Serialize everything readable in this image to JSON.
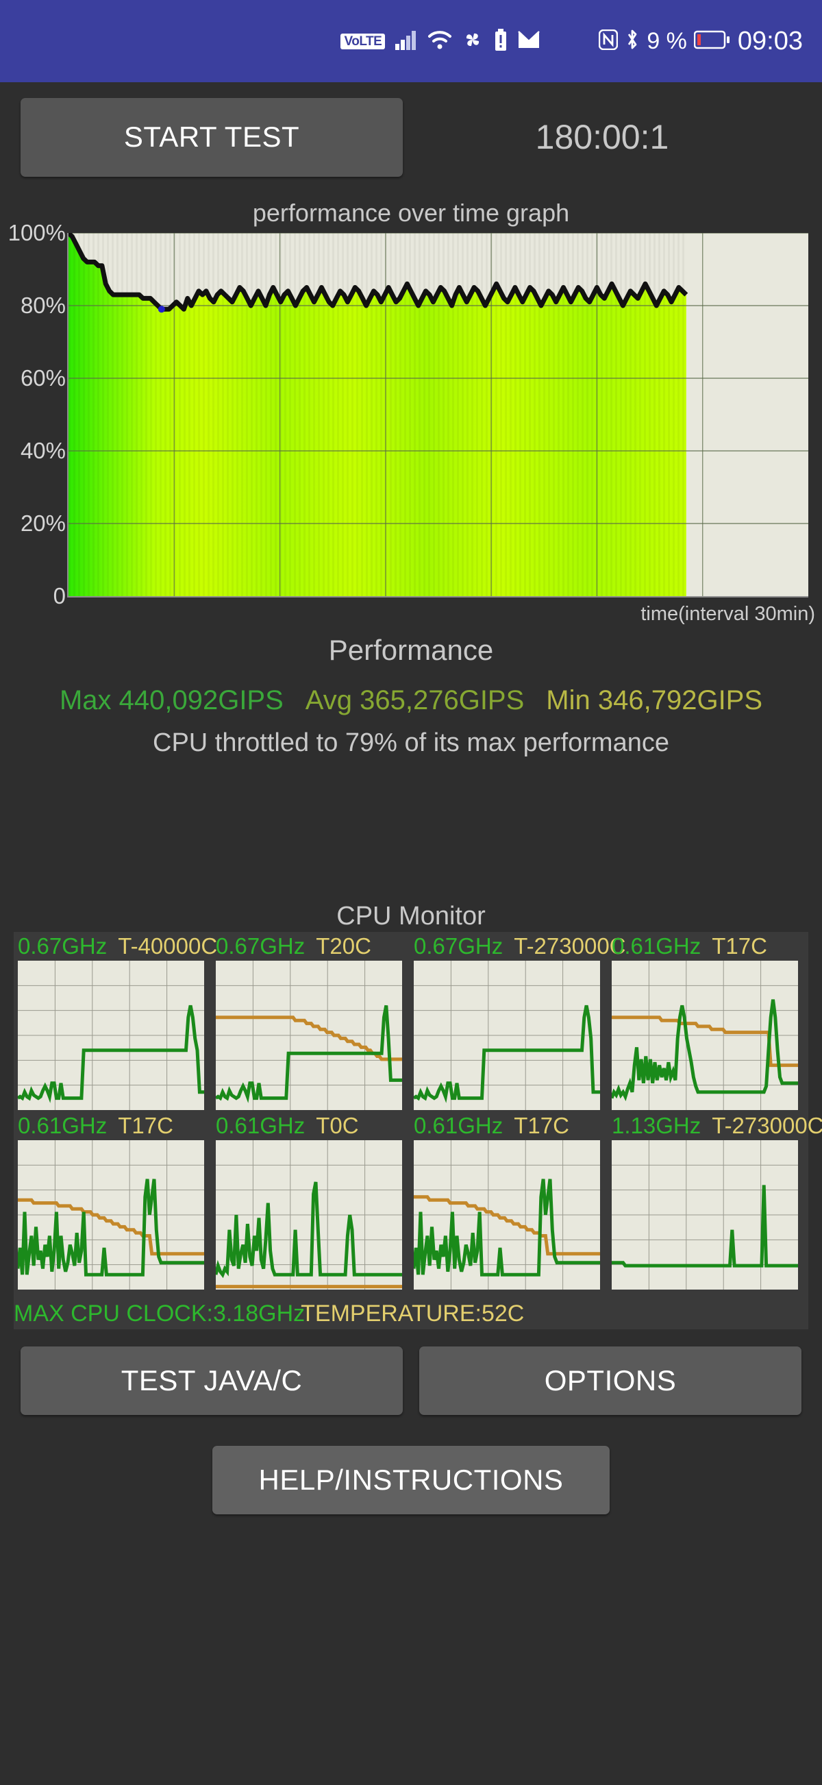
{
  "statusbar": {
    "volte": "VoLTE",
    "icons": [
      "volte-badge",
      "signal-bars-icon",
      "wifi-icon",
      "pinwheel-icon",
      "battery-alert-icon",
      "mail-icon",
      "nfc-icon",
      "bluetooth-icon",
      "battery-icon"
    ],
    "battery_percent": "9 %",
    "time": "09:03",
    "background_color": "#3b3f9e"
  },
  "toolbar": {
    "start_test_label": "START TEST",
    "timer": "180:00:1"
  },
  "chart_data": {
    "type": "line",
    "title": "performance over time graph",
    "xlabel": "time(interval 30min)",
    "ylabel": "",
    "ylim": [
      0,
      100
    ],
    "ytick_labels": [
      "100%",
      "80%",
      "60%",
      "40%",
      "20%",
      "0"
    ],
    "ytick_values": [
      100,
      80,
      60,
      40,
      20,
      0
    ],
    "grid": true,
    "x_gridline_count": 6,
    "fill": "green-to-yellow gradient",
    "line_color": "#111111",
    "plot_background": "#e8e8dd",
    "min_marker_color": "#2222cc",
    "data_fraction_drawn": 0.835,
    "values": [
      100,
      99,
      97,
      95,
      93,
      92,
      92,
      92,
      91,
      91,
      86,
      84,
      83,
      83,
      83,
      83,
      83,
      83,
      83,
      83,
      82,
      82,
      82,
      81,
      80,
      79,
      79,
      79,
      80,
      81,
      80,
      79,
      82,
      80,
      82,
      84,
      83,
      84,
      82,
      81,
      83,
      84,
      83,
      82,
      81,
      83,
      85,
      84,
      82,
      80,
      82,
      84,
      82,
      80,
      83,
      85,
      83,
      81,
      83,
      84,
      82,
      80,
      82,
      84,
      85,
      83,
      81,
      83,
      85,
      83,
      81,
      80,
      82,
      84,
      83,
      81,
      83,
      85,
      84,
      82,
      80,
      82,
      84,
      83,
      81,
      83,
      85,
      83,
      81,
      82,
      84,
      86,
      84,
      82,
      80,
      82,
      84,
      83,
      81,
      83,
      85,
      84,
      82,
      80,
      83,
      85,
      83,
      81,
      83,
      85,
      84,
      82,
      80,
      82,
      84,
      86,
      84,
      82,
      81,
      83,
      85,
      83,
      81,
      83,
      85,
      84,
      82,
      80,
      82,
      84,
      83,
      81,
      83,
      85,
      83,
      81,
      83,
      85,
      84,
      82,
      81,
      83,
      85,
      83,
      82,
      84,
      86,
      84,
      82,
      80,
      82,
      84,
      83,
      82,
      84,
      86,
      84,
      82,
      80,
      82,
      84,
      83,
      81,
      83,
      85,
      84,
      83
    ]
  },
  "performance": {
    "heading": "Performance",
    "max_label": "Max 440,092GIPS",
    "avg_label": "Avg 365,276GIPS",
    "min_label": "Min 346,792GIPS",
    "max_color": "#3aa83a",
    "avg_color": "#87a832",
    "min_color": "#b8b845",
    "throttle_note": "CPU throttled to 79% of its max performance"
  },
  "cpu_monitor": {
    "heading": "CPU Monitor",
    "freq_color": "#2db82d",
    "temp_color": "#e3cf6e",
    "cores": [
      {
        "freq": "0.67GHz",
        "temp": "T-40000C",
        "freq_trace": [
          8,
          9,
          8,
          12,
          9,
          8,
          13,
          10,
          9,
          8,
          9,
          13,
          16,
          13,
          9,
          18,
          18,
          8,
          8,
          18,
          8,
          8,
          8,
          8,
          8,
          8,
          8,
          8,
          8,
          40,
          40,
          40,
          40,
          40,
          40,
          40,
          40,
          40,
          40,
          40,
          40,
          40,
          40,
          40,
          40,
          40,
          40,
          40,
          40,
          40,
          40,
          40,
          40,
          40,
          40,
          40,
          40,
          40,
          40,
          40,
          40,
          40,
          40,
          40,
          40,
          40,
          40,
          40,
          40,
          40,
          40,
          40,
          40,
          40,
          40,
          62,
          70,
          62,
          48,
          40,
          12,
          12,
          12
        ],
        "temp_trace": null
      },
      {
        "freq": "0.67GHz",
        "temp": "T20C",
        "freq_trace": [
          8,
          9,
          8,
          12,
          9,
          8,
          13,
          10,
          9,
          8,
          9,
          13,
          16,
          13,
          9,
          18,
          18,
          8,
          8,
          18,
          8,
          8,
          8,
          8,
          8,
          8,
          8,
          8,
          8,
          8,
          8,
          8,
          38,
          38,
          38,
          38,
          38,
          38,
          38,
          38,
          38,
          38,
          38,
          38,
          38,
          38,
          38,
          38,
          38,
          38,
          38,
          38,
          38,
          38,
          38,
          38,
          38,
          38,
          38,
          38,
          38,
          38,
          38,
          38,
          38,
          38,
          38,
          38,
          38,
          38,
          38,
          38,
          38,
          38,
          62,
          70,
          48,
          20,
          20,
          20,
          20,
          20,
          20
        ],
        "temp_trace": [
          62,
          62,
          62,
          62,
          62,
          62,
          62,
          62,
          62,
          62,
          62,
          62,
          62,
          62,
          62,
          62,
          62,
          62,
          62,
          62,
          62,
          62,
          62,
          62,
          62,
          62,
          62,
          62,
          62,
          62,
          62,
          62,
          62,
          62,
          62,
          60,
          60,
          60,
          60,
          60,
          58,
          58,
          58,
          56,
          56,
          56,
          54,
          54,
          54,
          52,
          52,
          52,
          50,
          50,
          50,
          48,
          48,
          48,
          46,
          46,
          46,
          44,
          44,
          44,
          42,
          42,
          42,
          40,
          40,
          38,
          38,
          36,
          36,
          34,
          34,
          34,
          34,
          34,
          34,
          34,
          34,
          34,
          34
        ]
      },
      {
        "freq": "0.67GHz",
        "temp": "T-273000C",
        "freq_trace": [
          8,
          9,
          8,
          12,
          9,
          8,
          13,
          10,
          9,
          8,
          9,
          13,
          16,
          13,
          9,
          18,
          18,
          8,
          8,
          18,
          8,
          8,
          8,
          8,
          8,
          8,
          8,
          8,
          8,
          8,
          8,
          40,
          40,
          40,
          40,
          40,
          40,
          40,
          40,
          40,
          40,
          40,
          40,
          40,
          40,
          40,
          40,
          40,
          40,
          40,
          40,
          40,
          40,
          40,
          40,
          40,
          40,
          40,
          40,
          40,
          40,
          40,
          40,
          40,
          40,
          40,
          40,
          40,
          40,
          40,
          40,
          40,
          40,
          40,
          40,
          62,
          70,
          62,
          48,
          12,
          12,
          12,
          12
        ],
        "temp_trace": null
      },
      {
        "freq": "0.61GHz",
        "temp": "T17C",
        "freq_trace": [
          8,
          12,
          10,
          14,
          10,
          12,
          9,
          14,
          18,
          12,
          30,
          42,
          20,
          34,
          18,
          36,
          20,
          34,
          18,
          32,
          20,
          30,
          22,
          28,
          20,
          32,
          22,
          26,
          20,
          48,
          62,
          70,
          62,
          48,
          40,
          32,
          22,
          16,
          12,
          12,
          12,
          12,
          12,
          12,
          12,
          12,
          12,
          12,
          12,
          12,
          12,
          12,
          12,
          12,
          12,
          12,
          12,
          12,
          12,
          12,
          12,
          12,
          12,
          12,
          12,
          12,
          12,
          12,
          16,
          40,
          62,
          74,
          62,
          40,
          22,
          18,
          18,
          18,
          18,
          18,
          18,
          18,
          18
        ],
        "temp_trace": [
          62,
          62,
          62,
          62,
          62,
          62,
          62,
          62,
          62,
          62,
          62,
          62,
          62,
          62,
          62,
          62,
          62,
          62,
          62,
          62,
          62,
          62,
          60,
          60,
          60,
          60,
          60,
          60,
          60,
          60,
          58,
          58,
          58,
          58,
          58,
          58,
          58,
          58,
          56,
          56,
          56,
          56,
          56,
          56,
          54,
          54,
          54,
          54,
          54,
          54,
          52,
          52,
          52,
          52,
          52,
          52,
          52,
          52,
          52,
          52,
          52,
          52,
          52,
          52,
          52,
          52,
          52,
          52,
          52,
          52,
          30,
          30,
          30,
          30,
          30,
          30,
          30,
          30,
          30,
          30,
          30,
          30,
          30
        ]
      },
      {
        "freq": "0.61GHz",
        "temp": "T17C",
        "freq_trace": [
          14,
          28,
          10,
          52,
          10,
          24,
          36,
          16,
          42,
          20,
          26,
          14,
          30,
          22,
          36,
          12,
          26,
          52,
          14,
          36,
          20,
          12,
          18,
          30,
          24,
          16,
          38,
          18,
          26,
          52,
          10,
          10,
          10,
          10,
          10,
          10,
          10,
          10,
          28,
          10,
          10,
          10,
          10,
          10,
          10,
          10,
          10,
          10,
          10,
          10,
          10,
          10,
          10,
          10,
          10,
          10,
          62,
          74,
          50,
          62,
          74,
          40,
          22,
          18,
          18,
          18,
          18,
          18,
          18,
          18,
          18,
          18,
          18,
          18,
          18,
          18,
          18,
          18,
          18,
          18,
          18,
          18,
          18
        ],
        "temp_trace": [
          60,
          60,
          60,
          60,
          60,
          60,
          60,
          58,
          58,
          58,
          58,
          58,
          58,
          58,
          58,
          58,
          58,
          58,
          56,
          56,
          56,
          56,
          56,
          56,
          54,
          54,
          54,
          54,
          54,
          52,
          52,
          52,
          52,
          50,
          50,
          50,
          48,
          48,
          48,
          46,
          46,
          46,
          44,
          44,
          44,
          42,
          42,
          42,
          40,
          40,
          40,
          40,
          38,
          38,
          38,
          36,
          36,
          36,
          36,
          24,
          24,
          24,
          24,
          24,
          24,
          24,
          24,
          24,
          24,
          24,
          24,
          24,
          24,
          24,
          24,
          24,
          24,
          24,
          24,
          24,
          24,
          24,
          24
        ]
      },
      {
        "freq": "0.61GHz",
        "temp": "T0C",
        "freq_trace": [
          10,
          16,
          12,
          10,
          14,
          12,
          40,
          20,
          16,
          50,
          14,
          24,
          30,
          18,
          44,
          22,
          16,
          36,
          26,
          48,
          20,
          14,
          34,
          58,
          26,
          14,
          10,
          10,
          10,
          10,
          10,
          10,
          10,
          10,
          10,
          40,
          10,
          10,
          10,
          10,
          10,
          10,
          10,
          64,
          72,
          40,
          10,
          10,
          10,
          10,
          10,
          10,
          10,
          10,
          10,
          10,
          10,
          10,
          36,
          50,
          40,
          10,
          10,
          10,
          10,
          10,
          10,
          10,
          10,
          10,
          10,
          10,
          10,
          10,
          10,
          10,
          10,
          10,
          10,
          10,
          10,
          10,
          10
        ],
        "temp_trace": [
          2,
          2,
          2,
          2,
          2,
          2,
          2,
          2,
          2,
          2,
          2,
          2,
          2,
          2,
          2,
          2,
          2,
          2,
          2,
          2,
          2,
          2,
          2,
          2,
          2,
          2,
          2,
          2,
          2,
          2,
          2,
          2,
          2,
          2,
          2,
          2,
          2,
          2,
          2,
          2,
          2,
          2,
          2,
          2,
          2,
          2,
          2,
          2,
          2,
          2,
          2,
          2,
          2,
          2,
          2,
          2,
          2,
          2,
          2,
          2,
          2,
          2,
          2,
          2,
          2,
          2,
          2,
          2,
          2,
          2,
          2,
          2,
          2,
          2,
          2,
          2,
          2,
          2,
          2,
          2,
          2,
          2,
          2
        ]
      },
      {
        "freq": "0.61GHz",
        "temp": "T17C",
        "freq_trace": [
          14,
          28,
          10,
          52,
          10,
          24,
          36,
          16,
          42,
          20,
          26,
          14,
          30,
          22,
          36,
          12,
          26,
          52,
          14,
          36,
          20,
          12,
          18,
          30,
          24,
          16,
          38,
          18,
          26,
          52,
          10,
          10,
          10,
          10,
          10,
          10,
          10,
          10,
          28,
          10,
          10,
          10,
          10,
          10,
          10,
          10,
          10,
          10,
          10,
          10,
          10,
          10,
          10,
          10,
          10,
          10,
          62,
          74,
          50,
          62,
          74,
          40,
          22,
          18,
          18,
          18,
          18,
          18,
          18,
          18,
          18,
          18,
          18,
          18,
          18,
          18,
          18,
          18,
          18,
          18,
          18,
          18,
          18
        ],
        "temp_trace": [
          62,
          62,
          62,
          62,
          62,
          62,
          62,
          60,
          60,
          60,
          60,
          60,
          60,
          60,
          60,
          60,
          58,
          58,
          58,
          58,
          58,
          58,
          58,
          58,
          56,
          56,
          56,
          56,
          54,
          54,
          54,
          54,
          52,
          52,
          52,
          50,
          50,
          50,
          48,
          48,
          48,
          46,
          46,
          46,
          44,
          44,
          44,
          42,
          42,
          42,
          40,
          40,
          40,
          38,
          38,
          38,
          36,
          36,
          36,
          24,
          24,
          24,
          24,
          24,
          24,
          24,
          24,
          24,
          24,
          24,
          24,
          24,
          24,
          24,
          24,
          24,
          24,
          24,
          24,
          24,
          24,
          24,
          24
        ]
      },
      {
        "freq": "1.13GHz",
        "temp": "T-273000C",
        "freq_trace": [
          18,
          18,
          18,
          18,
          18,
          18,
          16,
          16,
          16,
          16,
          16,
          16,
          16,
          16,
          16,
          16,
          16,
          16,
          16,
          16,
          16,
          16,
          16,
          16,
          16,
          16,
          16,
          16,
          16,
          16,
          16,
          16,
          16,
          16,
          16,
          16,
          16,
          16,
          16,
          16,
          16,
          16,
          16,
          16,
          16,
          16,
          16,
          16,
          16,
          16,
          16,
          16,
          16,
          40,
          16,
          16,
          16,
          16,
          16,
          16,
          16,
          16,
          16,
          16,
          16,
          16,
          16,
          70,
          16,
          16,
          16,
          16,
          16,
          16,
          16,
          16,
          16,
          16,
          16,
          16,
          16,
          16,
          16
        ],
        "temp_trace": null
      }
    ],
    "footer_clock": "MAX CPU CLOCK:3.18GHz",
    "footer_temp": "TEMPERATURE:52C"
  },
  "buttons": {
    "test_java_c": "TEST JAVA/C",
    "options": "OPTIONS",
    "help_instructions": "HELP/INSTRUCTIONS"
  }
}
